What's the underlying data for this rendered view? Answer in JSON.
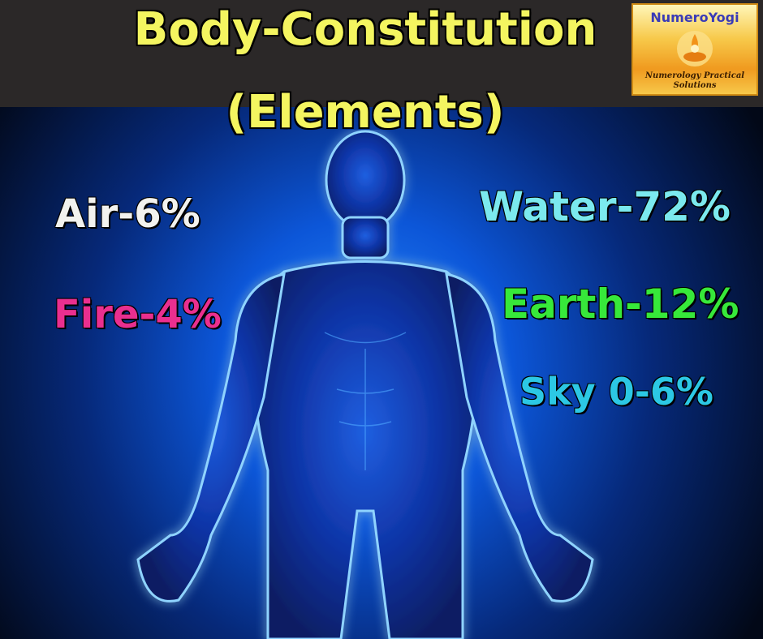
{
  "header": {
    "title_line1": "Body-Constitution",
    "title_line2": "(Elements)"
  },
  "logo": {
    "brand": "NumeroYogi",
    "tagline_line1": "Numerology Practical",
    "tagline_line2": "Solutions"
  },
  "elements": {
    "air": {
      "label": "Air-6%",
      "color": "#f2f2ee"
    },
    "fire": {
      "label": "Fire-4%",
      "color": "#ea2f8f"
    },
    "water": {
      "label": "Water-72%",
      "color": "#7be9ee"
    },
    "earth": {
      "label": "Earth-12%",
      "color": "#37e83a"
    },
    "sky": {
      "label": "Sky 0-6%",
      "color": "#2cc8e4"
    }
  },
  "colors": {
    "title": "#f4f560",
    "header_band": "#2b2828",
    "body_glow": "#2a8cff",
    "background_dark": "#020817"
  },
  "icons": {
    "logo_mark": "meditation-flame-icon",
    "figure": "human-body-figure"
  }
}
